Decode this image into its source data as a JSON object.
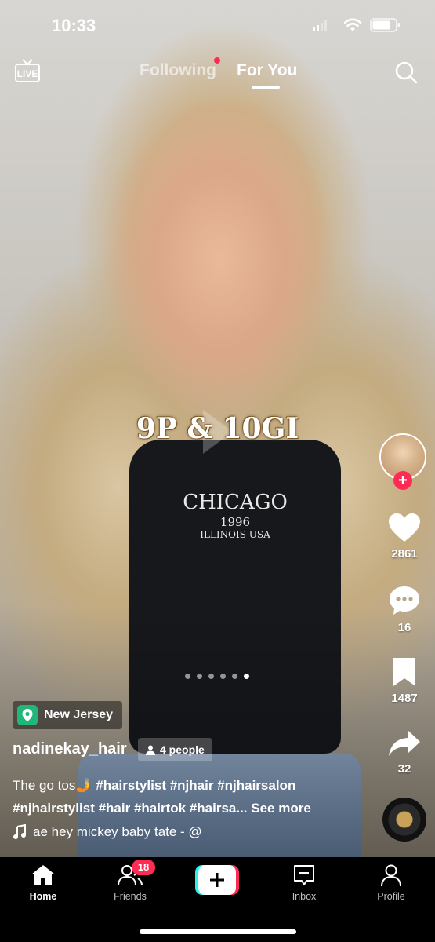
{
  "status_bar": {
    "time": "10:33"
  },
  "top_nav": {
    "live_label": "LIVE",
    "tabs": [
      {
        "label": "Following",
        "active": false,
        "has_dot": true
      },
      {
        "label": "For You",
        "active": true
      }
    ]
  },
  "video": {
    "overlay_text": "9P & 10GI",
    "shirt_line1": "CHICAGO",
    "shirt_line2": "1996",
    "shirt_line3": "ILLINOIS USA",
    "carousel": {
      "count": 6,
      "active_index": 5
    }
  },
  "right_rail": {
    "likes": "2861",
    "comments": "16",
    "bookmarks": "1487",
    "shares": "32"
  },
  "post": {
    "location": "New Jersey",
    "username": "nadinekay_hair",
    "people_tag": "4 people",
    "caption_line1_text": "The go tos",
    "caption_line1_emoji": "🤳",
    "caption_line1_tags": "#hairstylist #njhair #njhairsalon",
    "caption_line2_tags": "#njhairstylist #hair #hairtok #hairsa...",
    "see_more": "See more",
    "music": "ae    hey mickey baby tate - @"
  },
  "bottom_nav": {
    "items": [
      {
        "label": "Home",
        "icon": "home-icon",
        "active": true
      },
      {
        "label": "Friends",
        "icon": "friends-icon",
        "badge": "18"
      },
      {
        "label": "",
        "icon": "plus-icon"
      },
      {
        "label": "Inbox",
        "icon": "inbox-icon"
      },
      {
        "label": "Profile",
        "icon": "profile-icon"
      }
    ]
  },
  "colors": {
    "accent": "#fe2c55",
    "location_green": "#20b77a"
  }
}
